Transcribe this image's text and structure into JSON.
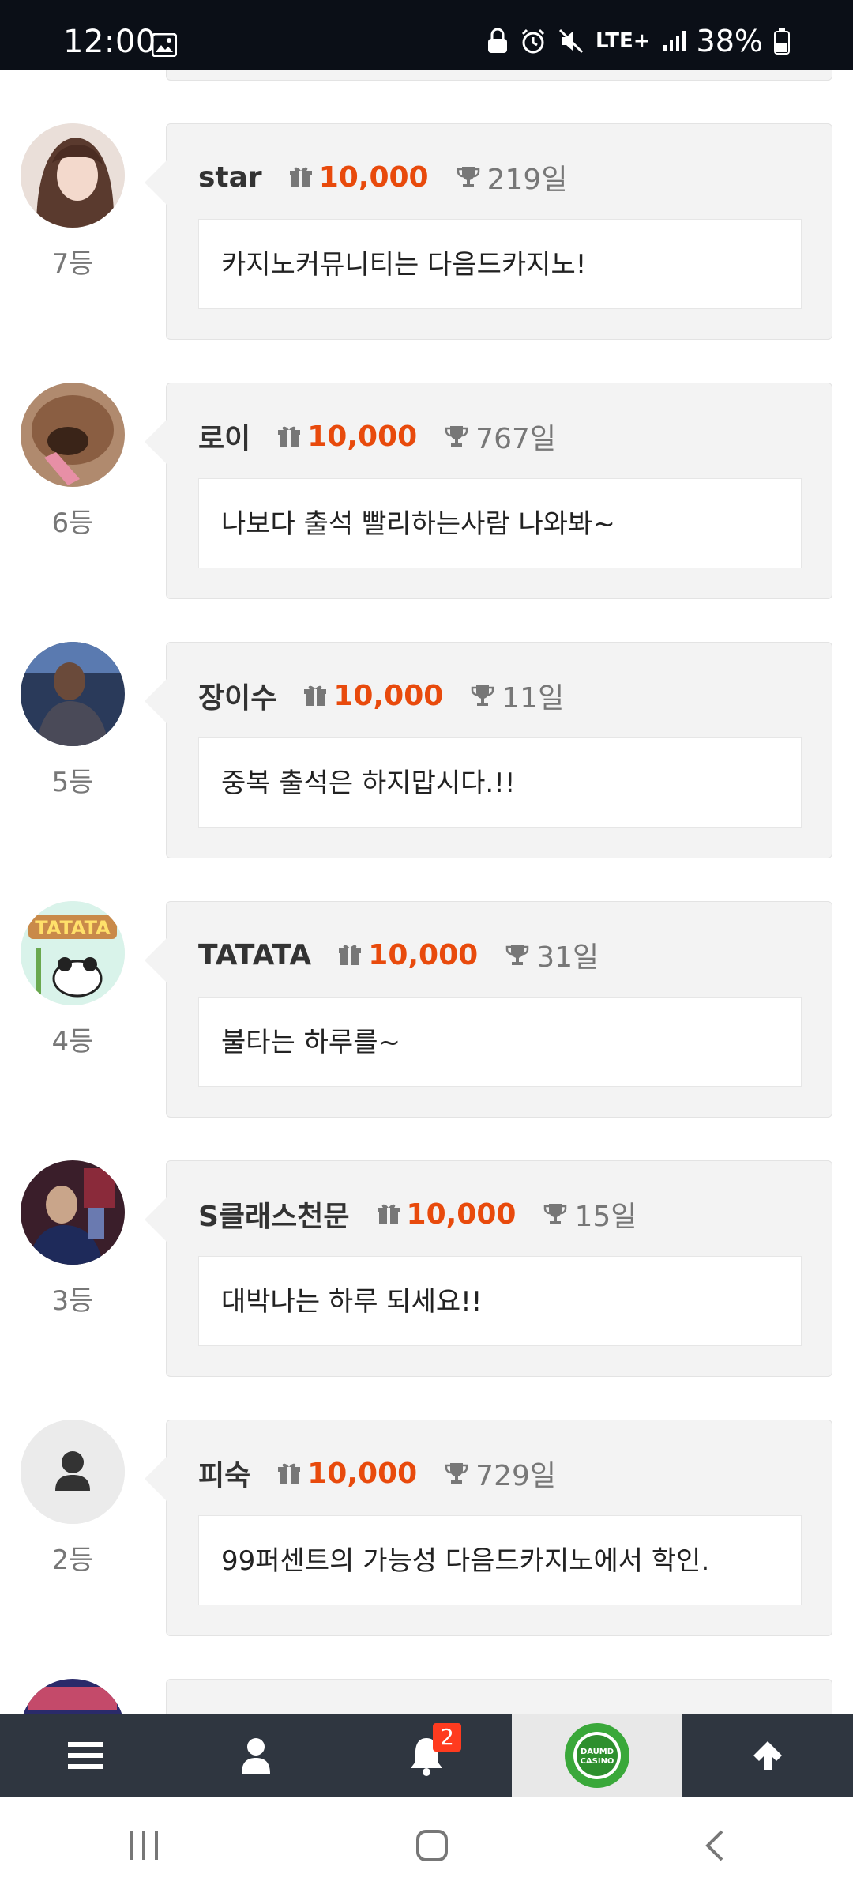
{
  "status_bar": {
    "time": "12:00",
    "network": "LTE+",
    "battery": "38%"
  },
  "entries": [
    {
      "name": "star",
      "points": "10,000",
      "days": "219일",
      "message": "카지노커뮤니티는 다음드카지노!",
      "rank": "7등",
      "avatar": "woman-portrait"
    },
    {
      "name": "로이",
      "points": "10,000",
      "days": "767일",
      "message": "나보다 출석 빨리하는사람 나와봐~",
      "rank": "6등",
      "avatar": "dog"
    },
    {
      "name": "장이수",
      "points": "10,000",
      "days": "11일",
      "message": "중복 출석은 하지맙시다.!!",
      "rank": "5등",
      "avatar": "man-portrait"
    },
    {
      "name": "TATATA",
      "points": "10,000",
      "days": "31일",
      "message": "불타는 하루를~",
      "rank": "4등",
      "avatar": "tatata-panda",
      "avatar_text": "TATATA"
    },
    {
      "name": "S클래스천문",
      "points": "10,000",
      "days": "15일",
      "message": "대박나는 하루 되세요!!",
      "rank": "3등",
      "avatar": "stage-photo"
    },
    {
      "name": "피숙",
      "points": "10,000",
      "days": "729일",
      "message": "99퍼센트의 가능성 다음드카지노에서 학인.",
      "rank": "2등",
      "avatar": "default-user"
    }
  ],
  "bottom_nav": {
    "items": [
      "menu-icon",
      "user-icon",
      "bell-icon",
      "daumd-casino-logo",
      "arrow-up-icon"
    ],
    "notification_count": "2",
    "logo_text": "DAUMD CASINO"
  },
  "colors": {
    "accent": "#e84a0c",
    "nav_bg": "#2f3640",
    "card_bg": "#f3f3f3"
  }
}
